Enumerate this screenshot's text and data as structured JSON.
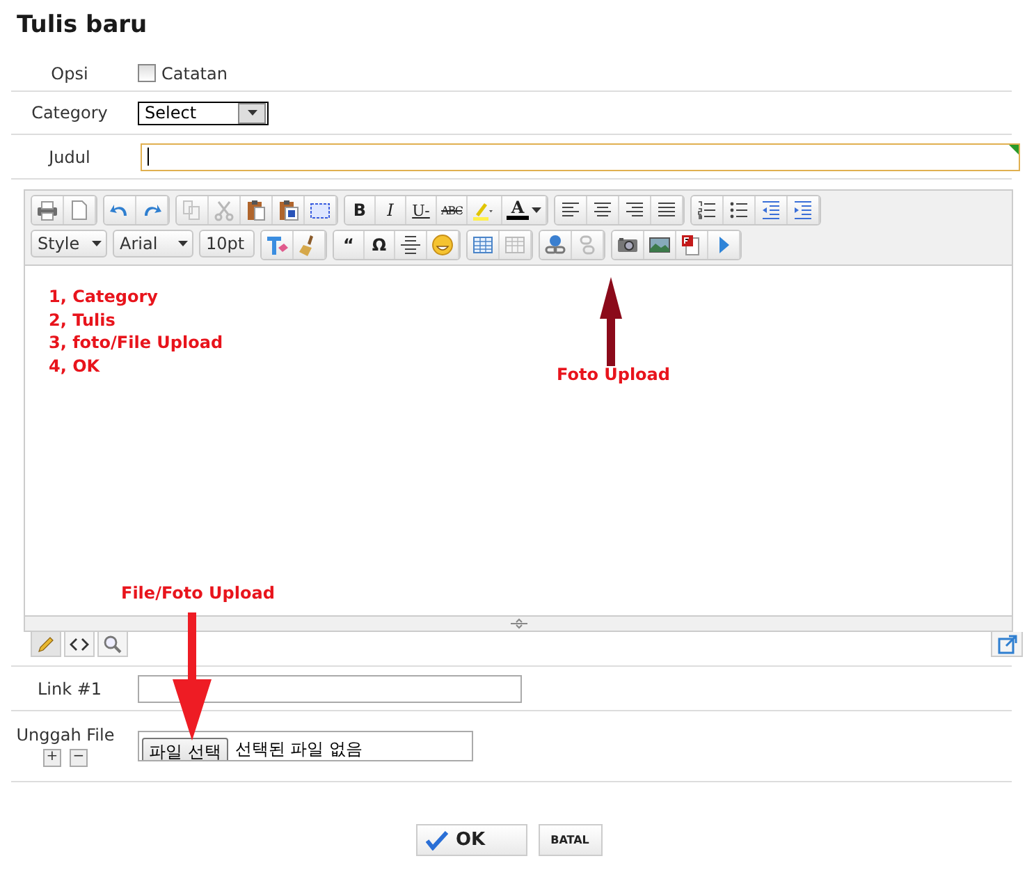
{
  "title": "Tulis baru",
  "options": {
    "label": "Opsi",
    "checkbox_label": "Catatan",
    "checked": false
  },
  "category": {
    "label": "Category",
    "value": "Select"
  },
  "title_field": {
    "label": "Judul"
  },
  "editor": {
    "toolbar_glyphs": [
      "B",
      "I",
      "U-",
      "ABC",
      "A",
      "“",
      "Ω"
    ],
    "dropdowns": [
      "Style",
      "Arial",
      "10pt"
    ],
    "content_lines": [
      "1, Category",
      "2, Tulis",
      "3, foto/File Upload",
      "4, OK"
    ]
  },
  "annotations": [
    {
      "text": "Foto Upload",
      "kind": "up"
    },
    {
      "text": "File/Foto Upload",
      "kind": "down"
    }
  ],
  "link": {
    "label": "Link #1"
  },
  "upload": {
    "label": "Unggah File",
    "button": "파일 선택",
    "status": "선택된 파일 없음",
    "add": "+",
    "remove": "−"
  },
  "buttons": [
    {
      "label": "OK",
      "kind": "primary"
    },
    {
      "label": "BATAL",
      "kind": "secondary"
    }
  ]
}
